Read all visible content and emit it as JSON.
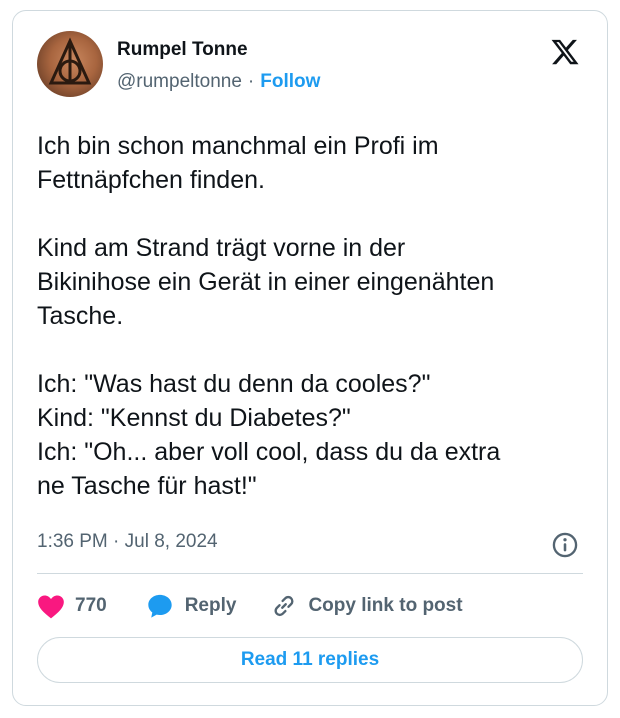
{
  "author": {
    "name": "Rumpel Tonne",
    "handle": "@rumpeltonne",
    "separator": "·",
    "follow_label": "Follow"
  },
  "tweet": {
    "text": "Ich bin schon manchmal ein Profi im\nFettnäpfchen finden.\n\nKind am Strand trägt vorne in der\nBikinihose ein Gerät in einer eingenähten\nTasche.\n\nIch: \"Was hast du denn da cooles?\"\nKind: \"Kennst du Diabetes?\"\nIch: \"Oh... aber voll cool, dass du da extra\nne Tasche für hast!\"",
    "timestamp": "1:36 PM · Jul 8, 2024"
  },
  "actions": {
    "like_count": "770",
    "reply_label": "Reply",
    "copy_label": "Copy link to post"
  },
  "read_replies_label": "Read 11 replies",
  "icons": {
    "brand": "x-logo-icon",
    "info": "info-icon",
    "like": "heart-icon",
    "reply": "speech-bubble-icon",
    "copy": "link-icon"
  },
  "colors": {
    "accent": "#1d9bf0",
    "heart": "#f91880",
    "text": "#0f1419",
    "muted": "#536471",
    "border": "#cfd9de"
  }
}
